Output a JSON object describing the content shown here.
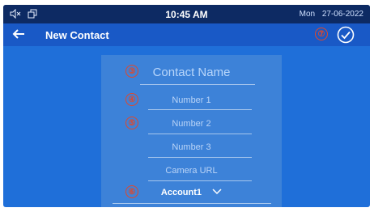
{
  "status_bar": {
    "time": "10:45 AM",
    "day": "Mon",
    "date": "27-06-2022",
    "icons": [
      "volume-muted-icon",
      "window-icon"
    ]
  },
  "header": {
    "title": "New Contact",
    "back_icon": "arrow-left-icon",
    "confirm_icon": "check-circle-icon"
  },
  "form": {
    "contact_name_placeholder": "Contact Name",
    "number1_placeholder": "Number 1",
    "number2_placeholder": "Number 2",
    "number3_placeholder": "Number 3",
    "camera_url_placeholder": "Camera URL",
    "account_value": "Account1"
  },
  "annotations": [
    "③",
    "④",
    "⑤",
    "⑥",
    "⑦"
  ],
  "colors": {
    "statusbar_bg": "#0d2a63",
    "titlebar_bg": "#1959c6",
    "screen_bg": "#1f6fd9",
    "form_bg": "#3d82d8",
    "annotation": "#e0482b"
  }
}
